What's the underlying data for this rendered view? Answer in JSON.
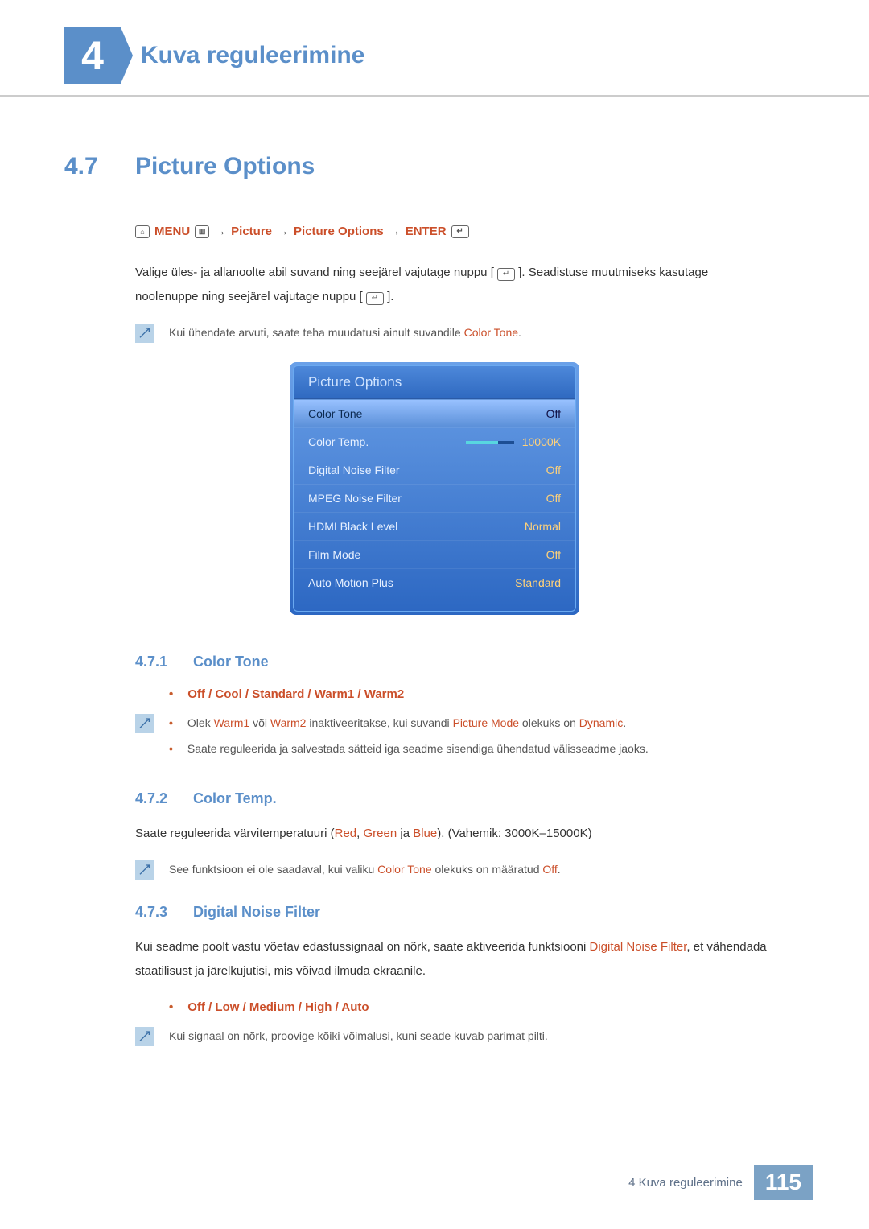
{
  "chapter": {
    "number": "4",
    "title": "Kuva reguleerimine"
  },
  "section": {
    "number": "4.7",
    "title": "Picture Options"
  },
  "nav": {
    "menu": "MENU",
    "arrows": "→",
    "picture": "Picture",
    "options": "Picture Options",
    "enter": "ENTER"
  },
  "intro": {
    "p1_a": "Valige üles- ja allanoolte abil suvand ning seejärel vajutage nuppu [",
    "p1_b": "]. Seadistuse muutmiseks kasutage",
    "p2_a": "noolenuppe ning seejärel vajutage nuppu [",
    "p2_b": "]."
  },
  "note1_a": "Kui ühendate arvuti, saate teha muudatusi ainult suvandile ",
  "note1_b": "Color Tone",
  "note1_c": ".",
  "osd": {
    "title": "Picture Options",
    "rows": [
      {
        "label": "Color Tone",
        "value": "Off",
        "selected": true
      },
      {
        "label": "Color Temp.",
        "value": "10000K",
        "slider": true
      },
      {
        "label": "Digital Noise Filter",
        "value": "Off"
      },
      {
        "label": "MPEG Noise Filter",
        "value": "Off"
      },
      {
        "label": "HDMI Black Level",
        "value": "Normal"
      },
      {
        "label": "Film Mode",
        "value": "Off"
      },
      {
        "label": "Auto Motion Plus",
        "value": "Standard"
      }
    ]
  },
  "sub1": {
    "num": "4.7.1",
    "title": "Color Tone",
    "opts": [
      "Off",
      "Cool",
      "Standard",
      "Warm1",
      "Warm2"
    ],
    "sep": " / ",
    "note_a1": "Olek ",
    "note_a2": "Warm1",
    "note_a3": " või ",
    "note_a4": "Warm2",
    "note_a5": " inaktiveeritakse, kui suvandi ",
    "note_a6": "Picture Mode",
    "note_a7": " olekuks on ",
    "note_a8": "Dynamic",
    "note_a9": ".",
    "note_b": "Saate reguleerida ja salvestada sätteid iga seadme sisendiga ühendatud välisseadme jaoks."
  },
  "sub2": {
    "num": "4.7.2",
    "title": "Color Temp.",
    "p_a": "Saate reguleerida värvitemperatuuri (",
    "p_red": "Red",
    "p_c1": ", ",
    "p_green": "Green",
    "p_c2": " ja ",
    "p_blue": "Blue",
    "p_b": "). (Vahemik: 3000K–15000K)",
    "note_a": "See funktsioon ei ole saadaval, kui valiku ",
    "note_b": "Color Tone",
    "note_c": " olekuks on määratud ",
    "note_d": "Off",
    "note_e": "."
  },
  "sub3": {
    "num": "4.7.3",
    "title": "Digital Noise Filter",
    "p_a": "Kui seadme poolt vastu võetav edastussignaal on nõrk, saate aktiveerida funktsiooni ",
    "p_red": "Digital Noise Filter",
    "p_b": ", et vähendada staatilisust ja järelkujutisi, mis võivad ilmuda ekraanile.",
    "opts": [
      "Off",
      "Low",
      "Medium",
      "High",
      "Auto"
    ],
    "sep": " / ",
    "note": "Kui signaal on nõrk, proovige kõiki võimalusi, kuni seade kuvab parimat pilti."
  },
  "footer": {
    "text": "4 Kuva reguleerimine",
    "page": "115"
  }
}
